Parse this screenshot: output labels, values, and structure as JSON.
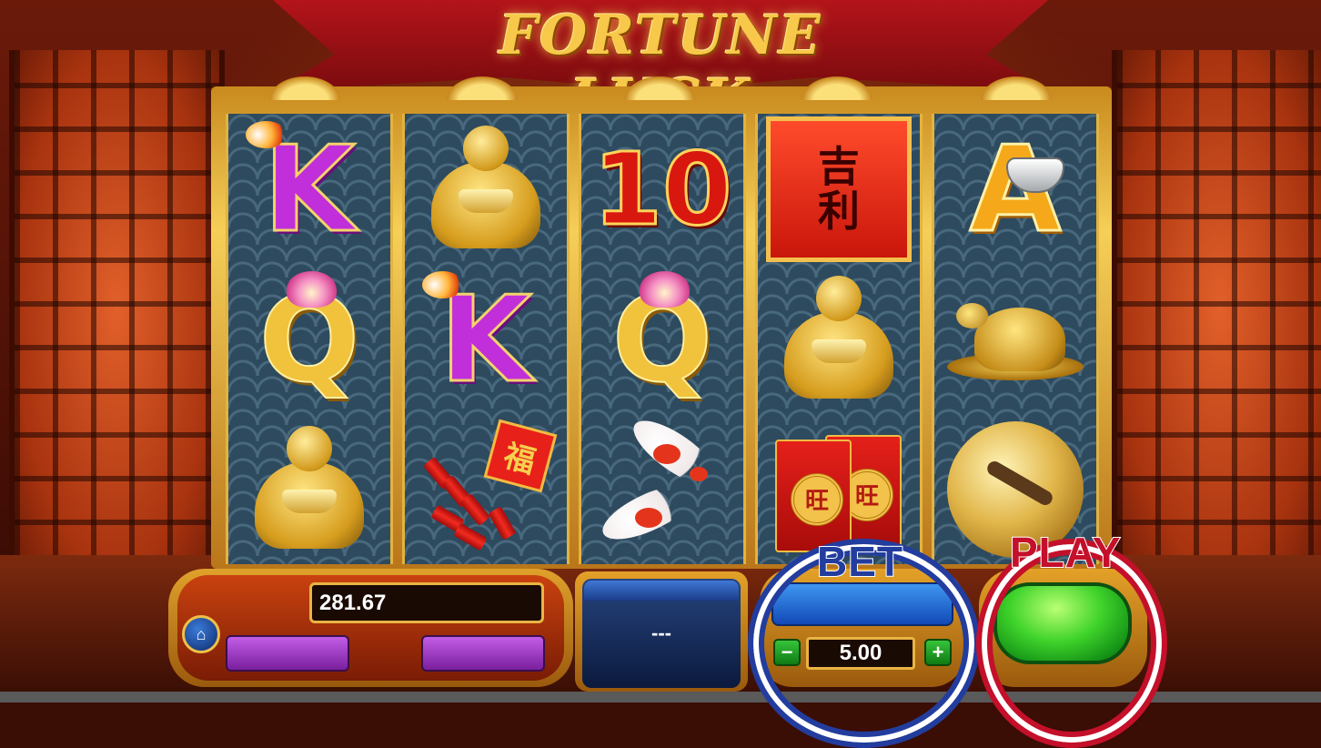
{
  "title": "FORTUNE LUCK",
  "balance": "281.67",
  "center_display": "---",
  "bet": {
    "label": "BET",
    "value": "5.00",
    "minus": "−",
    "plus": "+"
  },
  "play": {
    "label": "PLAY"
  },
  "home_icon": "home-icon",
  "reels": [
    {
      "symbols": [
        "K",
        "Q",
        "buddha"
      ]
    },
    {
      "symbols": [
        "buddha",
        "K",
        "firecrackers"
      ]
    },
    {
      "symbols": [
        "10",
        "Q",
        "koi"
      ]
    },
    {
      "symbols": [
        "scroll",
        "buddha",
        "red-envelopes"
      ]
    },
    {
      "symbols": [
        "A",
        "turtle",
        "gong"
      ]
    }
  ],
  "symbol_text": {
    "scroll": "吉\n利",
    "fu": "福",
    "envelope_seal": "旺"
  },
  "colors": {
    "bet_ring": "#233d9e",
    "play_ring": "#c4102a",
    "play_button": "#3fd32b",
    "bet_bar": "#3f96f0",
    "title_gold": "#f7c84a"
  }
}
